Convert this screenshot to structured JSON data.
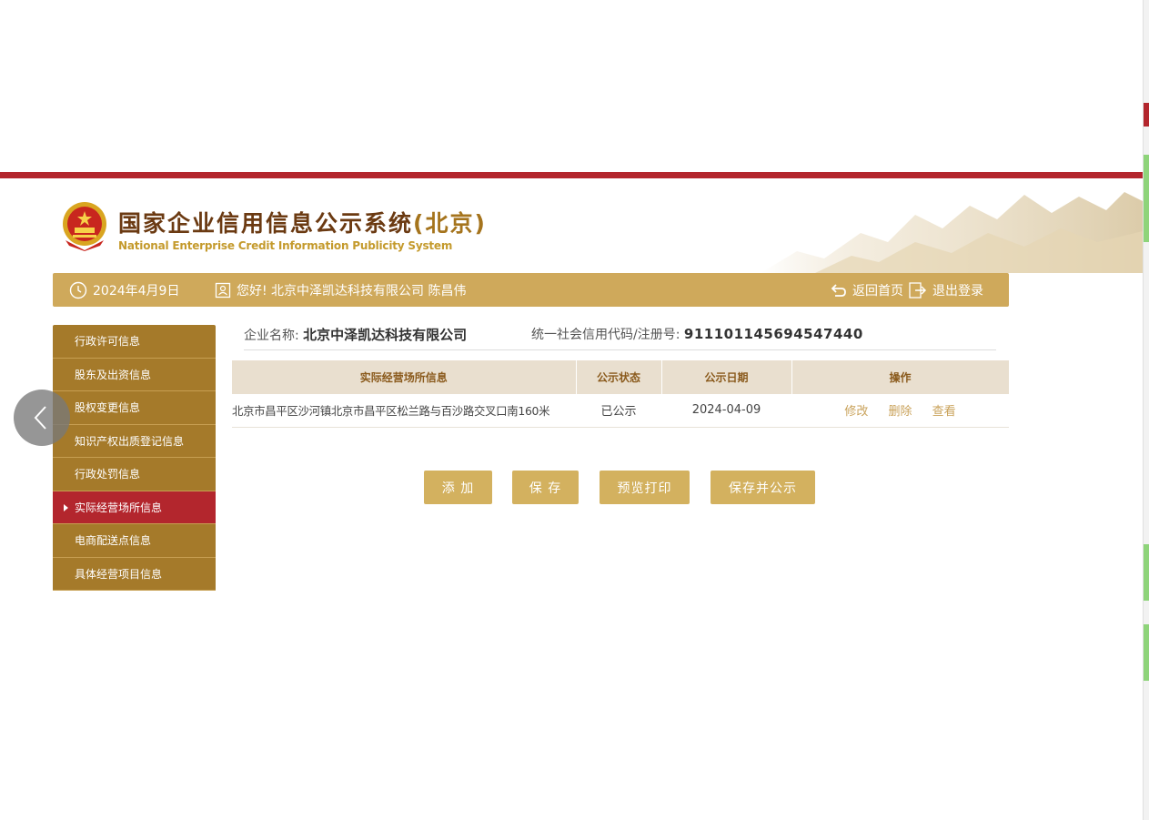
{
  "header": {
    "title_main": "国家企业信用信息公示系统",
    "title_region": "(北京)",
    "subtitle": "National Enterprise Credit Information Publicity System"
  },
  "topbar": {
    "date": "2024年4月9日",
    "greeting": "您好! 北京中泽凯达科技有限公司 陈昌伟",
    "home_link": "返回首页",
    "logout_link": "退出登录"
  },
  "sidebar": {
    "items": [
      {
        "label": "行政许可信息",
        "active": false
      },
      {
        "label": "股东及出资信息",
        "active": false
      },
      {
        "label": "股权变更信息",
        "active": false
      },
      {
        "label": "知识产权出质登记信息",
        "active": false
      },
      {
        "label": "行政处罚信息",
        "active": false
      },
      {
        "label": "实际经营场所信息",
        "active": true
      },
      {
        "label": "电商配送点信息",
        "active": false
      },
      {
        "label": "具体经营项目信息",
        "active": false
      }
    ]
  },
  "company": {
    "name_label": "企业名称:",
    "name_value": "北京中泽凯达科技有限公司",
    "code_label": "统一社会信用代码/注册号:",
    "code_value": "911101145694547440"
  },
  "table": {
    "headers": [
      "实际经营场所信息",
      "公示状态",
      "公示日期",
      "操作"
    ],
    "rows": [
      {
        "address": "北京市昌平区沙河镇北京市昌平区松兰路与百沙路交叉口南160米",
        "status": "已公示",
        "date": "2024-04-09",
        "ops": [
          "修改",
          "删除",
          "查看"
        ]
      }
    ]
  },
  "buttons": {
    "add": "添 加",
    "save": "保 存",
    "preview_print": "预览打印",
    "save_publish": "保存并公示"
  },
  "icons": {
    "clock": "clock-icon",
    "user_card": "user-card-icon",
    "return": "return-arrow-icon",
    "logout": "logout-icon",
    "back": "chevron-left-icon"
  },
  "colors": {
    "brand_red": "#b3262d",
    "gold_bar": "#cfa95b",
    "sidebar_brown": "#a57a2a",
    "button_gold": "#d3b15f",
    "table_header_bg": "#e9dfcf"
  }
}
